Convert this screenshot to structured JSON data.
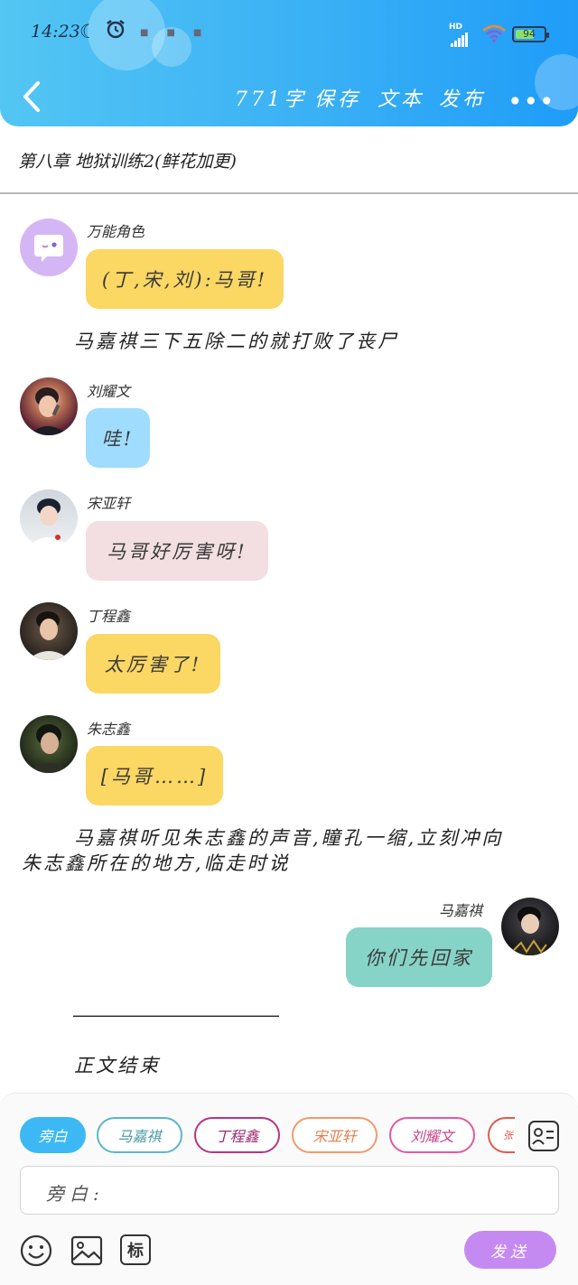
{
  "status_bar": {
    "time": "14:23",
    "network": "HD",
    "battery": "94"
  },
  "header": {
    "word_count": "771字",
    "save": "保存",
    "text": "文本",
    "publish": "发布"
  },
  "chapter": {
    "title": "第八章 地狱训练2(鲜花加更)"
  },
  "messages": [
    {
      "name": "万能角色",
      "text": "(丁,宋,刘):马哥!"
    },
    {
      "narration": "马嘉祺三下五除二的就打败了丧尸"
    },
    {
      "name": "刘耀文",
      "text": "哇!"
    },
    {
      "name": "宋亚轩",
      "text": "马哥好厉害呀!"
    },
    {
      "name": "丁程鑫",
      "text": "太厉害了!"
    },
    {
      "name": "朱志鑫",
      "text": "[马哥……]"
    },
    {
      "narration_line1": "马嘉祺听见朱志鑫的声音,瞳孔一缩,立刻冲向",
      "narration_line2": "朱志鑫所在的地方,临走时说"
    },
    {
      "name": "马嘉祺",
      "text": "你们先回家"
    },
    {
      "narration": "————————————"
    },
    {
      "narration": "正文结束"
    }
  ],
  "role_chips": [
    "旁白",
    "马嘉祺",
    "丁程鑫",
    "宋亚轩",
    "刘耀文",
    "张"
  ],
  "input": {
    "placeholder": "旁白:"
  },
  "toolbar": {
    "mark_label": "标",
    "send_label": "发送"
  },
  "colors": {
    "header_gradient_start": "#53c6f3",
    "header_gradient_end": "#1e9cf8",
    "bubble_yellow": "#fbd763",
    "bubble_blue": "#9fdcfd",
    "bubble_pink": "#f3dfe1",
    "bubble_teal": "#86d3c8",
    "send_purple": "#c58af2"
  }
}
